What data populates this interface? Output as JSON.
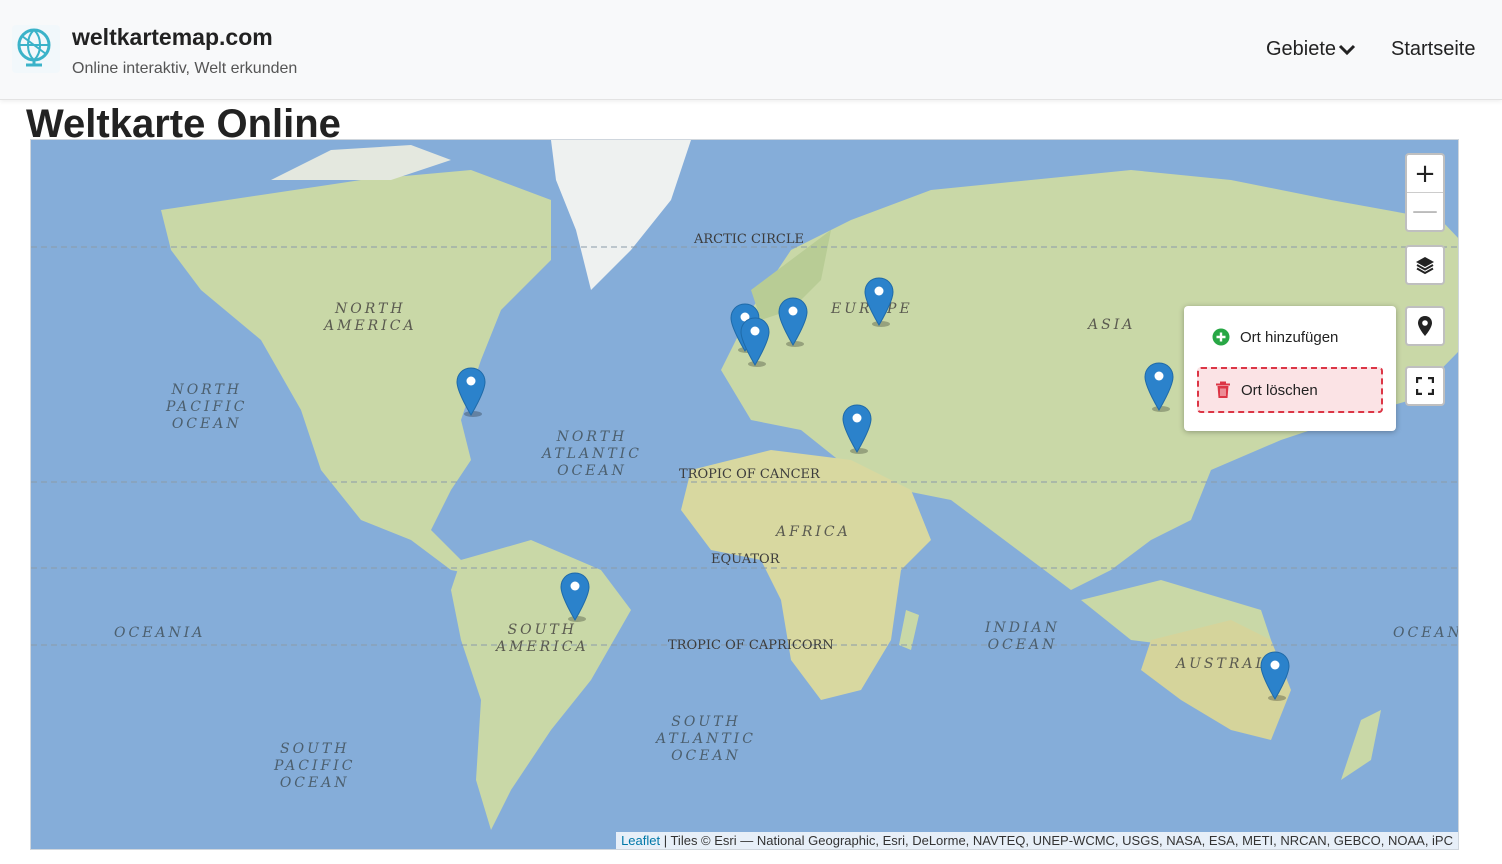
{
  "header": {
    "site_name": "weltkartemap.com",
    "tagline": "Online interaktiv, Welt erkunden",
    "nav": {
      "gebiete": "Gebiete",
      "startseite": "Startseite"
    }
  },
  "page_title": "Weltkarte Online",
  "map": {
    "labels": {
      "arctic_circle": "ARCTIC CIRCLE",
      "tropic_cancer": "TROPIC OF CANCER",
      "equator": "EQUATOR",
      "tropic_capricorn": "TROPIC OF CAPRICORN",
      "north_america": "NORTH\nAMERICA",
      "south_america": "SOUTH\nAMERICA",
      "europe": "EUROPE",
      "asia": "ASIA",
      "africa": "AFRICA",
      "australia": "AUSTRALIA",
      "north_pacific": "NORTH\nPACIFIC\nOCEAN",
      "north_atlantic": "NORTH\nATLANTIC\nOCEAN",
      "south_atlantic": "SOUTH\nATLANTIC\nOCEAN",
      "south_pacific": "SOUTH\nPACIFIC\nOCEAN",
      "indian_ocean": "INDIAN\nOCEAN",
      "oceania_left": "OCEANIA",
      "oceania_right": "OCEANIA"
    },
    "controls": {
      "zoom_in": "+",
      "zoom_out": "—",
      "layers_icon": "layers-icon",
      "location_icon": "map-marker-icon",
      "fullscreen_icon": "fullscreen-icon"
    },
    "popup": {
      "add_label": "Ort hinzufügen",
      "delete_label": "Ort löschen"
    },
    "attribution": {
      "leaflet": "Leaflet",
      "tiles": " | Tiles © Esri — National Geographic, Esri, DeLorme, NAVTEQ, UNEP-WCMC, USGS, NASA, ESA, METI, NRCAN, GEBCO, NOAA, iPC"
    },
    "marker_color": "#2b82cb",
    "water_color": "#7fa8d6",
    "land_color": "#c9d9a8"
  }
}
